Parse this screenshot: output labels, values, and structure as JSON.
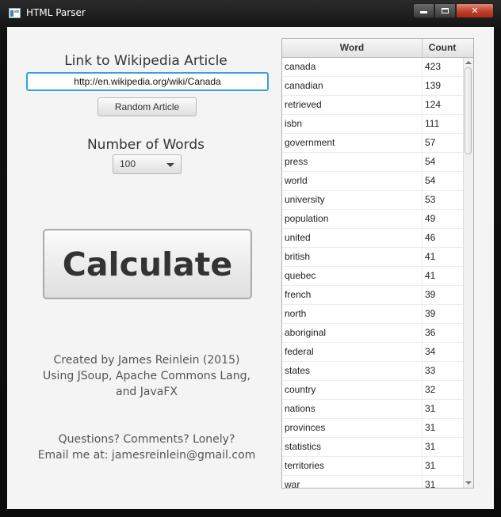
{
  "window": {
    "title": "HTML Parser"
  },
  "form": {
    "link_label": "Link to Wikipedia Article",
    "url_value": "http://en.wikipedia.org/wiki/Canada",
    "random_label": "Random Article",
    "words_label": "Number of Words",
    "words_selected": "100",
    "calculate_label": "Calculate"
  },
  "credits": {
    "line1": "Created by James Reinlein (2015)",
    "line2": "Using JSoup, Apache Commons Lang,",
    "line3": "and JavaFX",
    "line4": "Questions? Comments? Lonely?",
    "line5": "Email me at: jamesreinlein@gmail.com"
  },
  "table": {
    "col_word": "Word",
    "col_count": "Count",
    "rows": [
      {
        "word": "canada",
        "count": "423"
      },
      {
        "word": "canadian",
        "count": "139"
      },
      {
        "word": "retrieved",
        "count": "124"
      },
      {
        "word": "isbn",
        "count": "111"
      },
      {
        "word": "government",
        "count": "57"
      },
      {
        "word": "press",
        "count": "54"
      },
      {
        "word": "world",
        "count": "54"
      },
      {
        "word": "university",
        "count": "53"
      },
      {
        "word": "population",
        "count": "49"
      },
      {
        "word": "united",
        "count": "46"
      },
      {
        "word": "british",
        "count": "41"
      },
      {
        "word": "quebec",
        "count": "41"
      },
      {
        "word": "french",
        "count": "39"
      },
      {
        "word": "north",
        "count": "39"
      },
      {
        "word": "aboriginal",
        "count": "36"
      },
      {
        "word": "federal",
        "count": "34"
      },
      {
        "word": "states",
        "count": "33"
      },
      {
        "word": "country",
        "count": "32"
      },
      {
        "word": "nations",
        "count": "31"
      },
      {
        "word": "provinces",
        "count": "31"
      },
      {
        "word": "statistics",
        "count": "31"
      },
      {
        "word": "territories",
        "count": "31"
      },
      {
        "word": "war",
        "count": "31"
      }
    ]
  }
}
